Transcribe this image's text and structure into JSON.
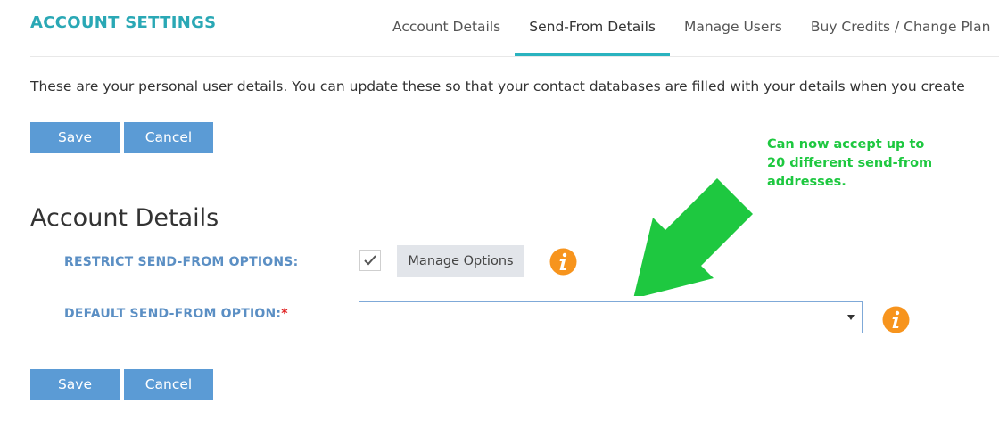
{
  "header": {
    "title": "ACCOUNT SETTINGS",
    "tabs": [
      {
        "label": "Account Details",
        "active": false
      },
      {
        "label": "Send-From Details",
        "active": true
      },
      {
        "label": "Manage Users",
        "active": false
      },
      {
        "label": "Buy Credits / Change Plan",
        "active": false
      }
    ]
  },
  "intro_text": "These are your personal user details. You can update these so that your contact databases are filled with your details when you create",
  "buttons": {
    "save_label": "Save",
    "cancel_label": "Cancel"
  },
  "section": {
    "title": "Account Details",
    "restrict_label": "RESTRICT SEND-FROM OPTIONS:",
    "restrict_checked": true,
    "manage_options_label": "Manage Options",
    "default_label": "DEFAULT SEND-FROM OPTION:",
    "default_required_marker": "*",
    "default_value": ""
  },
  "annotation": {
    "text": "Can now accept up to 20 different send-from addresses."
  },
  "colors": {
    "accent": "#2aa8b5",
    "button": "#5b9bd5",
    "label": "#5b8fc4",
    "info": "#f7941d",
    "annotation": "#1ec840"
  },
  "icons": {
    "check": "checkmark-icon",
    "info": "info-icon",
    "caret": "caret-down-icon",
    "arrow": "green-arrow"
  }
}
